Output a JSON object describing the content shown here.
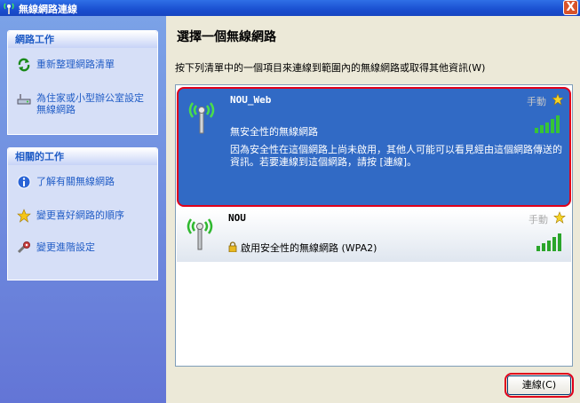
{
  "window": {
    "title": "無線網路連線",
    "close_label": "X"
  },
  "left_pane": {
    "network_tasks": {
      "header": "網路工作",
      "items": [
        {
          "label": "重新整理網路清單",
          "icon": "refresh-icon"
        },
        {
          "label": "為住家或小型辦公室設定無線網路",
          "icon": "setup-icon"
        }
      ]
    },
    "related_tasks": {
      "header": "相關的工作",
      "items": [
        {
          "label": "了解有關無線網路",
          "icon": "info-icon"
        },
        {
          "label": "變更喜好網路的順序",
          "icon": "star-icon"
        },
        {
          "label": "變更進階設定",
          "icon": "settings-icon"
        }
      ]
    }
  },
  "main": {
    "heading": "選擇一個無線網路",
    "instruction": "按下列清單中的一個項目來連線到範圍內的無線網路或取得其他資訊(W)",
    "networks": [
      {
        "ssid": "NOU_Web",
        "mode": "手動",
        "security": "無安全性的無線網路",
        "description": "因為安全性在這個網路上尚未啟用，其他人可能可以看見經由這個網路傳送的資訊。若要連線到這個網路，請按 [連線]。",
        "selected": true,
        "signal_bars": 5
      },
      {
        "ssid": "NOU",
        "mode": "手動",
        "security": "啟用安全性的無線網路 (WPA2)",
        "selected": false,
        "signal_bars": 5
      }
    ],
    "connect_button": "連線(C)"
  },
  "colors": {
    "selected_bg": "#316ac5",
    "highlight": "#e0001b",
    "task_link": "#215dc6"
  }
}
